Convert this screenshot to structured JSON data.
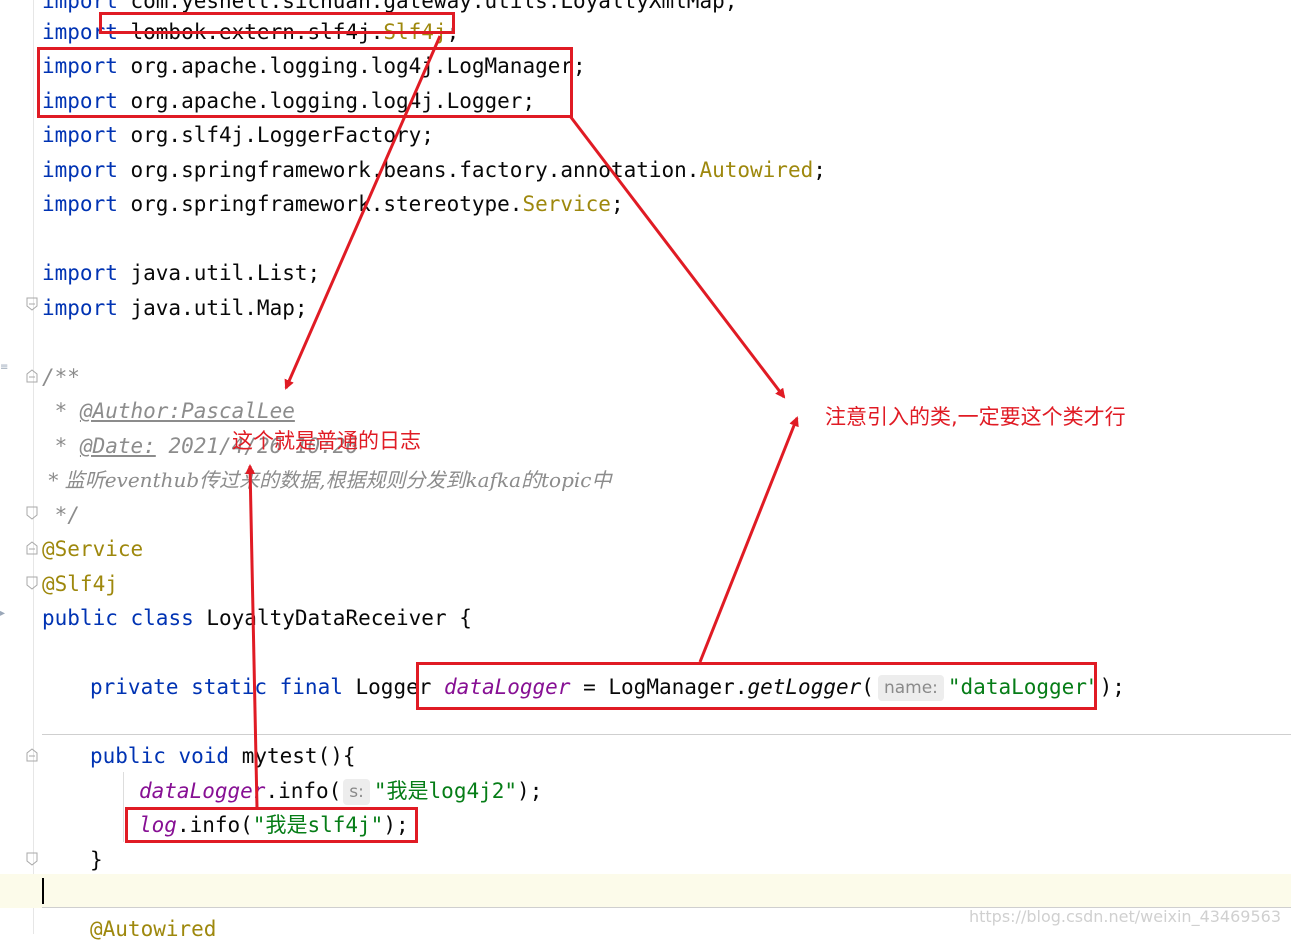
{
  "code": {
    "line0": {
      "kw": "import",
      "text": " com.yeshell.sichuan.gateway.utils.LoyaltyXmlMap;"
    },
    "line1": {
      "kw": "import",
      "text": " lombok.extern.slf4j.",
      "ann": "Slf4j",
      "tail": ";"
    },
    "line2": {
      "kw": "import",
      "text": " org.apache.logging.log4j.LogManager;"
    },
    "line3": {
      "kw": "import",
      "text": " org.apache.logging.log4j.Logger;"
    },
    "line4": {
      "kw": "import",
      "text": " org.slf4j.LoggerFactory;"
    },
    "line5": {
      "kw": "import",
      "text": " org.springframework.beans.factory.annotation.",
      "ann": "Autowired",
      "tail": ";"
    },
    "line6": {
      "kw": "import",
      "text": " org.springframework.stereotype.",
      "ann": "Service",
      "tail": ";"
    },
    "line7": {
      "kw": "import",
      "text": " java.util.List;"
    },
    "line8": {
      "kw": "import",
      "text": " java.util.Map;"
    },
    "doc_open": "/**",
    "doc_author_prefix": " * ",
    "doc_author": "@Author:PascalLee",
    "doc_date_prefix": " * ",
    "doc_date_tag": "@Date:",
    "doc_date_val": " 2021/4/26 10:26",
    "doc_desc": " * 监听eventhub传过来的数据,根据规则分发到kafka的topic中",
    "doc_close": " */",
    "ann_service": "@Service",
    "ann_slf4j": "@Slf4j",
    "class_kw1": "public",
    "class_kw2": "class",
    "class_name": " LoyaltyDataReceiver {",
    "field_mods": "private static final",
    "field_type": " Logger ",
    "field_name": "dataLogger",
    "field_assign": " = LogManager.",
    "field_method": "getLogger",
    "field_paren": "(",
    "field_hint": "name:",
    "field_arg": "\"dataLogger\"",
    "field_end": ");",
    "method_kw": "public void",
    "method_sig": " mytest(){",
    "call1_obj": "dataLogger",
    "call1_mid": ".info(",
    "call1_hint": "s:",
    "call1_arg": "\"我是log4j2\"",
    "call1_end": ");",
    "call2_obj": "log",
    "call2_mid": ".info(",
    "call2_arg": "\"我是slf4j\"",
    "call2_end": ");",
    "close_brace": "}",
    "autowired": "@Autowired"
  },
  "annotations": {
    "note1": "这个就是普通的日志",
    "note2": "注意引入的类,一定要这个类才行"
  },
  "watermark": "https://blog.csdn.net/weixin_43469563",
  "colors": {
    "highlight": "#e01b24",
    "keyword": "#0033b3",
    "annotation": "#9e880d",
    "string": "#067d17",
    "field": "#871094"
  }
}
